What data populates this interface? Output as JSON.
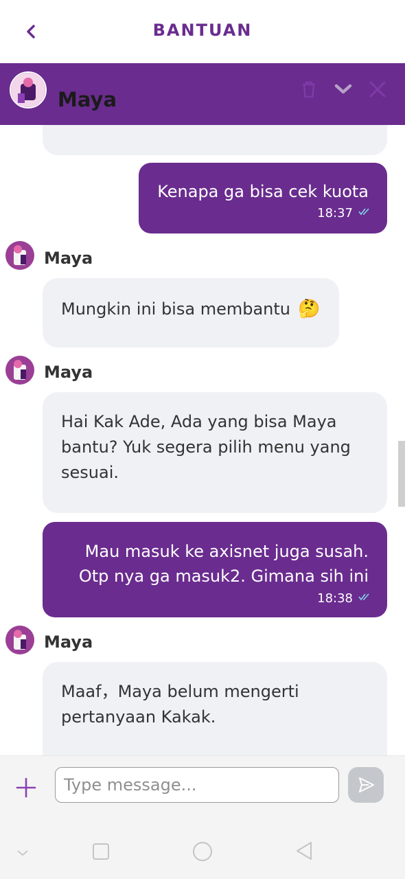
{
  "app_bar": {
    "title": "BANTUAN",
    "back_icon": "chevron-left-icon"
  },
  "chat_header": {
    "agent_name": "Maya",
    "icons": [
      "trash-icon",
      "chevron-down-icon",
      "close-icon"
    ]
  },
  "messages": [
    {
      "from": "bot",
      "text": ""
    },
    {
      "from": "user",
      "text": "Kenapa ga bisa cek kuota",
      "time": "18:37"
    },
    {
      "from": "bot",
      "sender": "Maya",
      "text": "Mungkin ini bisa membantu",
      "emoji": "🤔"
    },
    {
      "from": "bot",
      "sender": "Maya",
      "lines": [
        "Hai Kak Ade, Ada yang bisa Maya",
        "bantu? Yuk segera pilih menu yang",
        "sesuai."
      ]
    },
    {
      "from": "user",
      "lines": [
        "Mau masuk ke axisnet juga susah.",
        "Otp nya ga masuk2. Gimana sih ini"
      ],
      "time": "18:38"
    },
    {
      "from": "bot",
      "sender": "Maya",
      "lines": [
        "Maaf，Maya belum mengerti",
        "pertanyaan Kakak."
      ]
    }
  ],
  "composer": {
    "placeholder": "Type message...",
    "value": ""
  },
  "colors": {
    "brand_purple": "#6a2c8f",
    "bubble_grey": "#eff1f5",
    "read_tick": "#7fd3e8"
  }
}
